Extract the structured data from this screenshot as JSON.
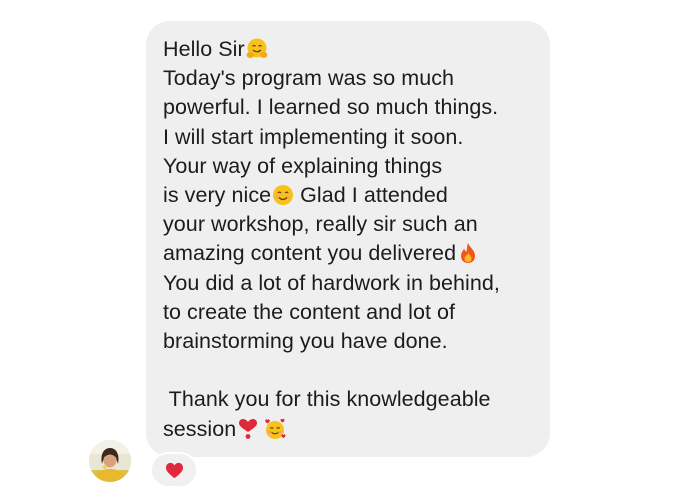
{
  "message": {
    "lines": [
      {
        "text": "Hello Sir",
        "emoji": "hugging-face-icon"
      },
      {
        "text": "Today's program was so much"
      },
      {
        "text": "powerful. I learned so much things."
      },
      {
        "text": "I will start implementing it soon."
      },
      {
        "text": "Your way of explaining things"
      },
      {
        "text": "is very nice",
        "emoji": "smiling-face-icon",
        "after": " Glad I attended"
      },
      {
        "text": "your workshop, really sir such an"
      },
      {
        "text": "amazing content you delivered",
        "emoji": "fire-icon"
      },
      {
        "text": "You did a lot of hardwork in behind,"
      },
      {
        "text": "to create the content and lot of"
      },
      {
        "text": "brainstorming you have done."
      },
      {
        "text": ""
      },
      {
        "text": " Thank you for this knowledgeable"
      },
      {
        "text": "session",
        "emoji": "heart-exclamation-icon",
        "emoji2": "smiling-face-with-hearts-icon"
      }
    ]
  },
  "reaction": {
    "icon": "red-heart-icon",
    "color": "#e0283c"
  },
  "avatar": {
    "icon": "profile-photo"
  },
  "colors": {
    "bubble": "#efefef",
    "text": "#1c1c1c"
  }
}
